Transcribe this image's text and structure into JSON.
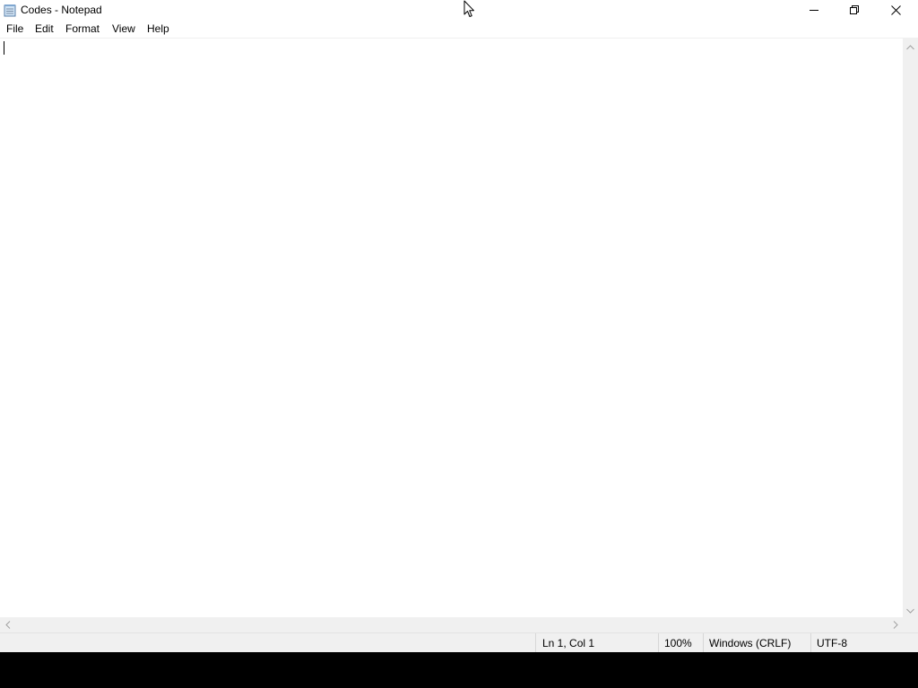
{
  "window": {
    "title": "Codes - Notepad",
    "app_icon": "notepad-icon"
  },
  "caption_buttons": {
    "minimize_icon": "minimize-icon",
    "restore_icon": "restore-icon",
    "close_icon": "close-icon"
  },
  "menu": {
    "items": [
      {
        "label": "File"
      },
      {
        "label": "Edit"
      },
      {
        "label": "Format"
      },
      {
        "label": "View"
      },
      {
        "label": "Help"
      }
    ]
  },
  "editor": {
    "content": ""
  },
  "statusbar": {
    "position": "Ln 1, Col 1",
    "zoom": "100%",
    "line_ending": "Windows (CRLF)",
    "encoding": "UTF-8"
  },
  "colors": {
    "window_bg": "#ffffff",
    "chrome_bg": "#f0f0f0",
    "desktop_bg": "#000000"
  }
}
